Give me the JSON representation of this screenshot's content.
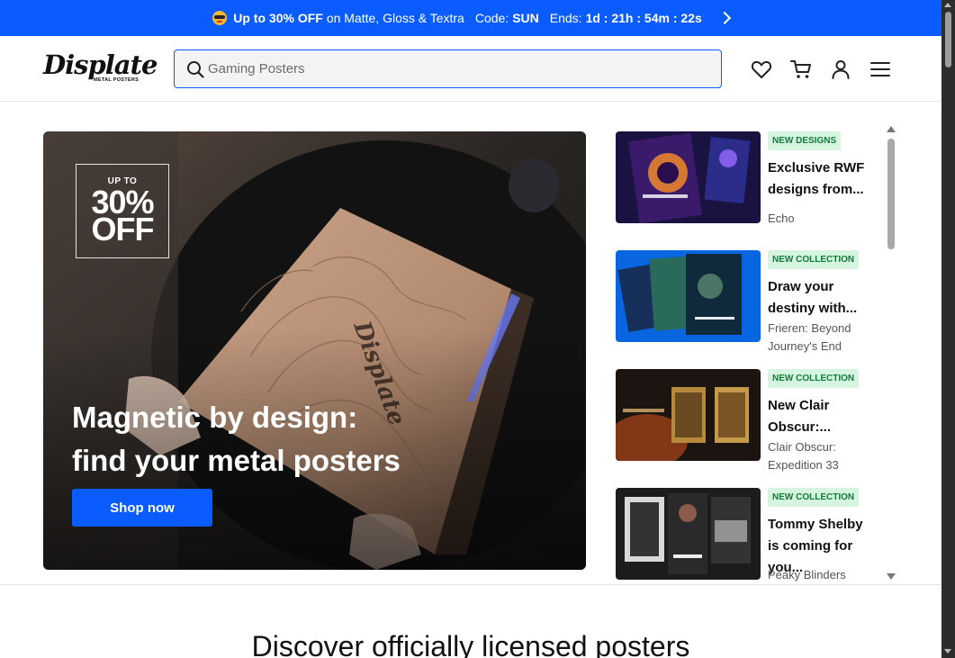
{
  "promo": {
    "headline": "Up to 30% OFF",
    "text": "on Matte, Gloss & Textra",
    "code_label": "Code:",
    "code": "SUN",
    "ends_label": "Ends:",
    "countdown": "1d : 21h : 54m : 22s"
  },
  "header": {
    "logo_text": "Displate",
    "logo_subtitle": "METAL POSTERS",
    "search_placeholder": "Gaming Posters",
    "icons": [
      "heart-icon",
      "cart-icon",
      "user-icon",
      "menu-icon"
    ]
  },
  "hero": {
    "badge_top": "UP TO",
    "badge_percent": "30%",
    "badge_off": "OFF",
    "headline_line1": "Magnetic by design:",
    "headline_line2": "find your metal posters",
    "cta": "Shop now"
  },
  "side_cards": [
    {
      "tag": "NEW DESIGNS",
      "title": "Exclusive RWF designs from...",
      "subtitle": "Echo"
    },
    {
      "tag": "NEW COLLECTION",
      "title": "Draw your destiny with...",
      "subtitle": "Frieren: Beyond Journey's End"
    },
    {
      "tag": "NEW COLLECTION",
      "title": "New Clair Obscur:...",
      "subtitle": "Clair Obscur: Expedition 33"
    },
    {
      "tag": "NEW COLLECTION",
      "title": "Tommy Shelby is coming for you...",
      "subtitle": "Peaky Blinders"
    }
  ],
  "discover_title": "Discover officially licensed posters",
  "colors": {
    "accent": "#0a5cff",
    "tag_bg": "#d6f5e0",
    "tag_text": "#137a3a"
  }
}
